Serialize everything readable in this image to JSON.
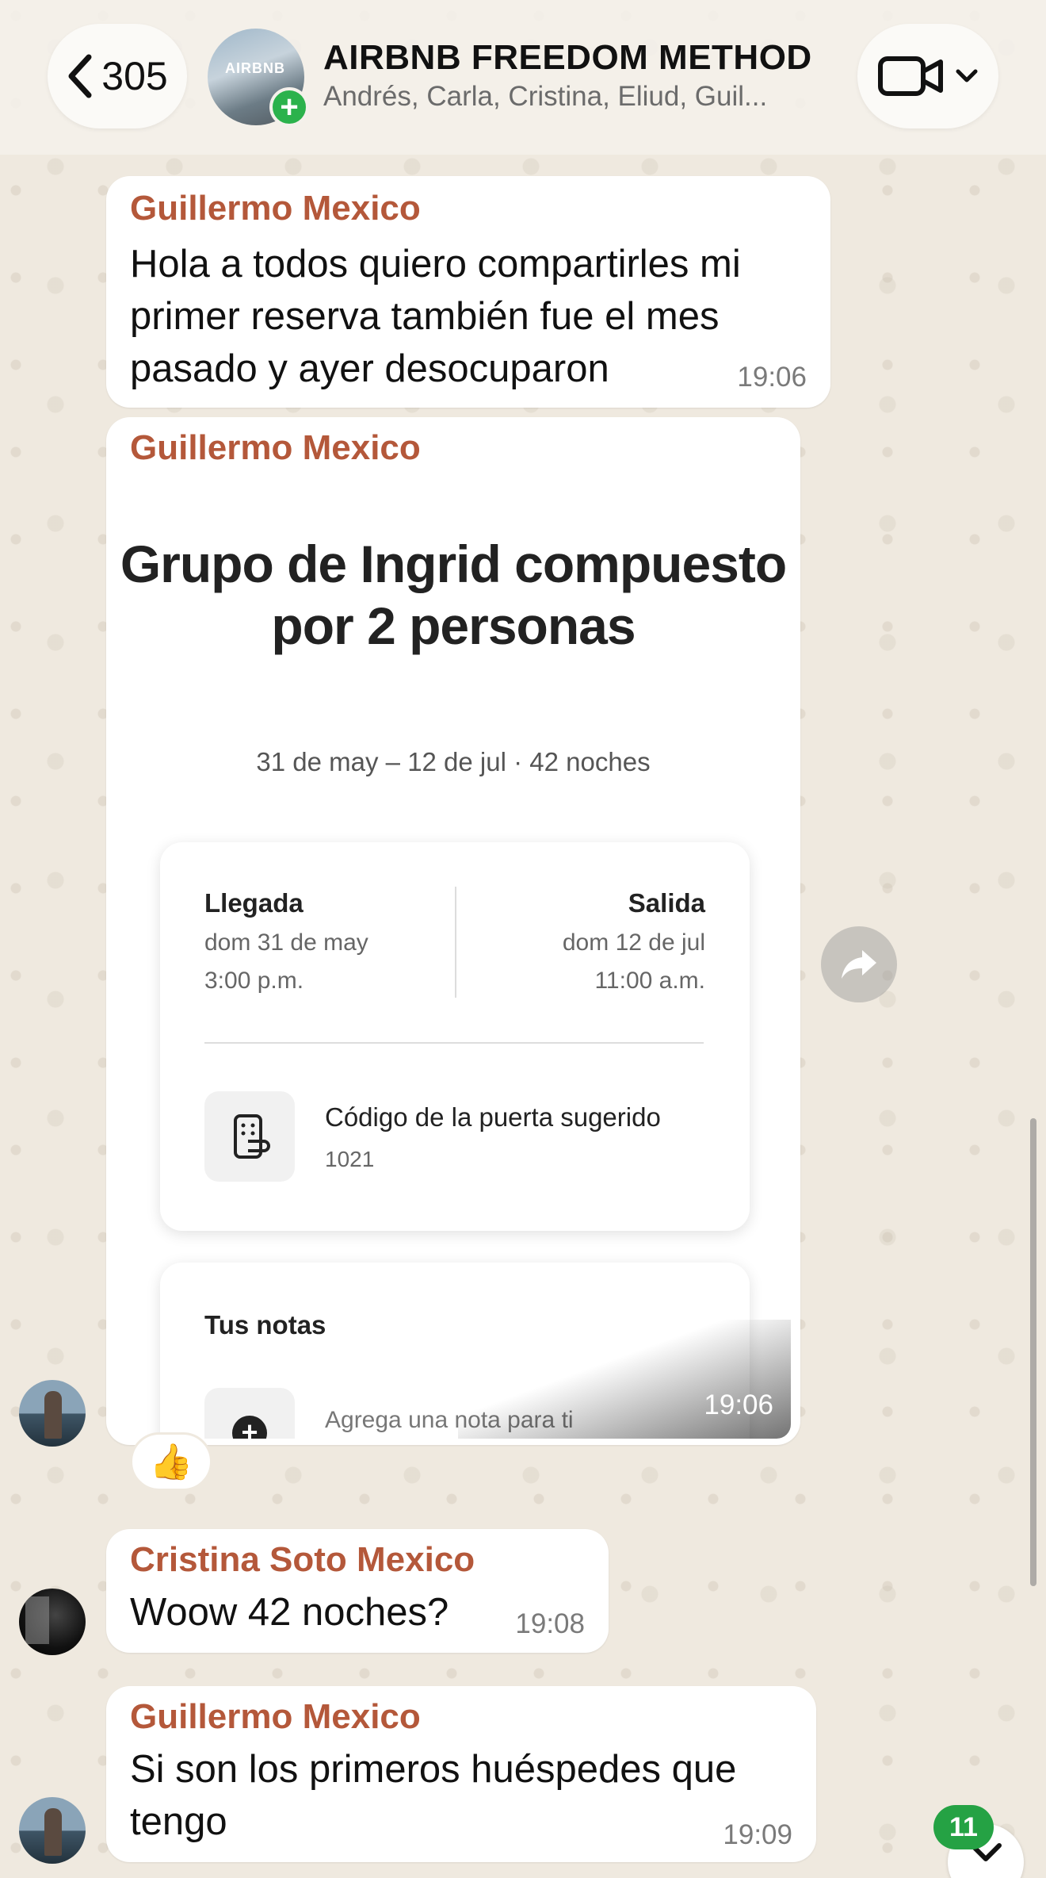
{
  "header": {
    "back_count": "305",
    "group_name": "AIRBNB FREEDOM METHOD",
    "members": "Andrés, Carla, Cristina, Eliud, Guil...",
    "avatar_logo_text": "AIRBNB"
  },
  "messages": [
    {
      "sender": "Guillermo Mexico",
      "text": "Hola a todos quiero compartirles mi primer reserva también fue el mes pasado y ayer desocuparon",
      "time": "19:06"
    },
    {
      "sender": "Guillermo Mexico",
      "time": "19:06",
      "screenshot": {
        "title": "Grupo de Ingrid compuesto por 2 personas",
        "dates": "31 de may – 12 de jul · 42 noches",
        "checkin_label": "Llegada",
        "checkin_date": "dom 31 de may",
        "checkin_time": "3:00 p.m.",
        "checkout_label": "Salida",
        "checkout_date": "dom 12 de jul",
        "checkout_time": "11:00 a.m.",
        "door_code_label": "Código de la puerta sugerido",
        "door_code_value": "1021",
        "notes_title": "Tus notas",
        "note_placeholder": "Agrega una nota para ti"
      },
      "reaction": "👍"
    },
    {
      "sender": "Cristina Soto Mexico",
      "text": "Woow 42 noches?",
      "time": "19:08"
    },
    {
      "sender": "Guillermo Mexico",
      "text": "Si son los primeros huéspedes que tengo",
      "time": "19:09"
    }
  ],
  "unread_count": "11",
  "colors": {
    "sender_name": "#b4583a",
    "unread_badge": "#25a244",
    "add_badge": "#2bb24c",
    "wallpaper": "#efe9df"
  },
  "icons": [
    "chevron-left-icon",
    "plus-icon",
    "video-camera-icon",
    "chevron-down-icon",
    "forward-icon",
    "smart-lock-icon",
    "add-note-icon"
  ]
}
